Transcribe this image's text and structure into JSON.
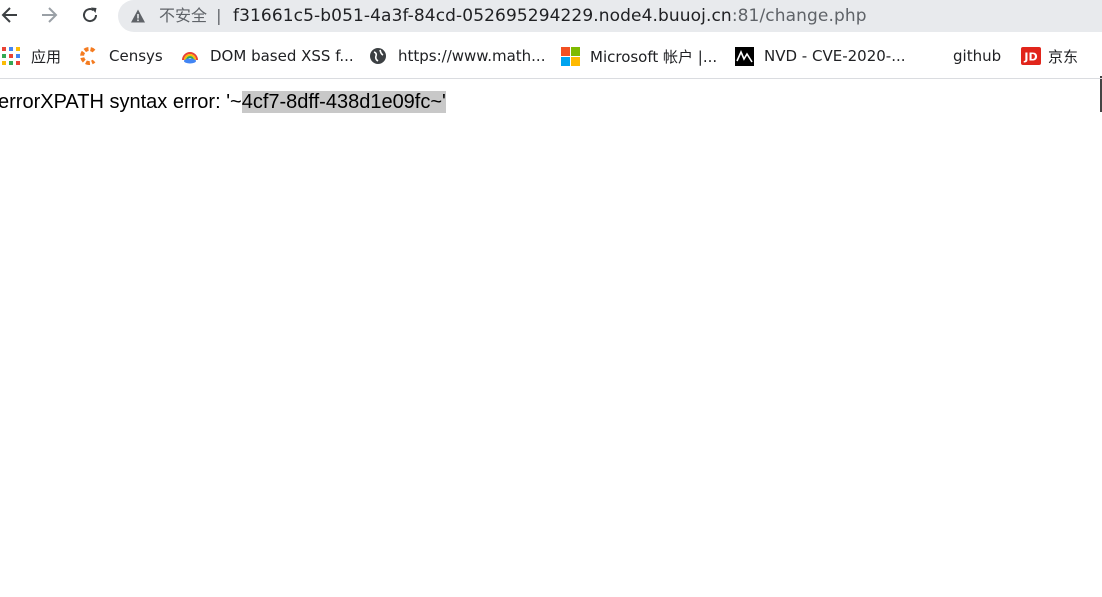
{
  "browser": {
    "security_label": "不安全",
    "url_host": "f31661c5-b051-4a3f-84cd-052695294229.node4.buuoj.cn",
    "url_rest": ":81/change.php"
  },
  "bookmarks": [
    {
      "label": "应用",
      "icon": "apps-grid-icon"
    },
    {
      "label": "Censys",
      "icon": "censys-icon"
    },
    {
      "label": "DOM based XSS f...",
      "icon": "cloud-rainbow-icon"
    },
    {
      "label": "https://www.math...",
      "icon": "globe-icon"
    },
    {
      "label": "Microsoft 帐户 |...",
      "icon": "microsoft-icon"
    },
    {
      "label": "NVD - CVE-2020-...",
      "icon": "nvd-icon"
    },
    {
      "label": "github",
      "icon": ""
    },
    {
      "label": "京东",
      "icon": "jd-icon"
    }
  ],
  "page": {
    "text_prefix": "errorXPATH syntax error: '~",
    "text_selected": "4cf7-8dff-438d1e09fc~'"
  },
  "colors": {
    "selection": "#c8c8c8",
    "omnibox": "#e8eaed"
  }
}
